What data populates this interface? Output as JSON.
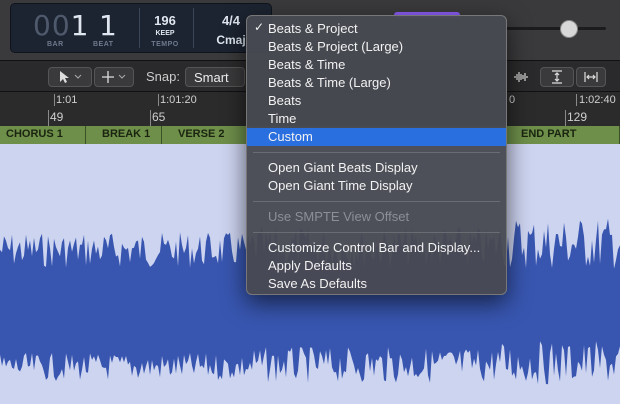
{
  "lcd": {
    "bar_dim": "00",
    "bar_value": "1",
    "beat_value": "1",
    "bar_label": "BAR",
    "beat_label": "BEAT",
    "tempo_value": "196",
    "tempo_mode": "KEEP",
    "tempo_label": "TEMPO",
    "time_signature": "4/4",
    "key": "Cmaj"
  },
  "toolbar": {
    "snap_label": "Snap:",
    "snap_value": "Smart"
  },
  "ruler": {
    "top_labels": [
      "1:01",
      "1:01:20",
      "0",
      "1:02:40"
    ],
    "bar_labels": [
      "49",
      "65",
      "129"
    ]
  },
  "markers": [
    "CHORUS 1",
    "BREAK 1",
    "VERSE 2",
    "END PART"
  ],
  "menu": {
    "group1": [
      "Beats & Project",
      "Beats & Project (Large)",
      "Beats & Time",
      "Beats & Time (Large)",
      "Beats",
      "Time",
      "Custom"
    ],
    "checked_item": "Beats & Project",
    "selected_item": "Custom",
    "group2": [
      "Open Giant Beats Display",
      "Open Giant Time Display"
    ],
    "group3": [
      "Use SMPTE View Offset"
    ],
    "group4": [
      "Customize Control Bar and Display...",
      "Apply Defaults",
      "Save As Defaults"
    ],
    "check_glyph": "✓"
  },
  "colors": {
    "menu_highlight": "#2a6fe0",
    "region": "#3856b0",
    "marker": "#6e8f4a"
  }
}
